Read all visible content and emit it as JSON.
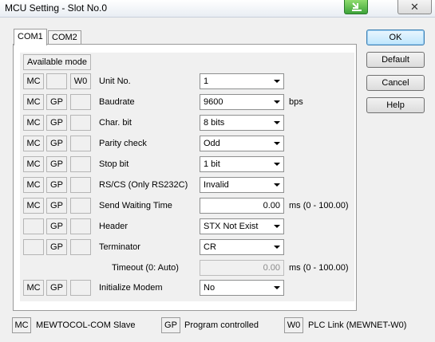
{
  "window": {
    "title": "MCU Setting - Slot No.0"
  },
  "tabs": [
    {
      "label": "COM1"
    },
    {
      "label": "COM2"
    }
  ],
  "available_mode_label": "Available mode",
  "rows": [
    {
      "mode": [
        "MC",
        "",
        "W0"
      ],
      "label": "Unit No.",
      "value": "1",
      "unit": ""
    },
    {
      "mode": [
        "MC",
        "GP",
        ""
      ],
      "label": "Baudrate",
      "value": "9600",
      "unit": "bps"
    },
    {
      "mode": [
        "MC",
        "GP",
        ""
      ],
      "label": "Char. bit",
      "value": "8 bits",
      "unit": ""
    },
    {
      "mode": [
        "MC",
        "GP",
        ""
      ],
      "label": "Parity check",
      "value": "Odd",
      "unit": ""
    },
    {
      "mode": [
        "MC",
        "GP",
        ""
      ],
      "label": "Stop bit",
      "value": "1 bit",
      "unit": ""
    },
    {
      "mode": [
        "MC",
        "GP",
        ""
      ],
      "label": "RS/CS (Only RS232C)",
      "value": "Invalid",
      "unit": ""
    },
    {
      "mode": [
        "MC",
        "GP",
        ""
      ],
      "label": "Send Waiting Time",
      "value": "0.00",
      "unit": "ms (0 - 100.00)"
    },
    {
      "mode": [
        "",
        "GP",
        ""
      ],
      "label": "Header",
      "value": "STX Not Exist",
      "unit": ""
    },
    {
      "mode": [
        "",
        "GP",
        ""
      ],
      "label": "Terminator",
      "value": "CR",
      "unit": ""
    },
    {
      "mode": [
        "",
        "",
        ""
      ],
      "label": "Timeout (0: Auto)",
      "value": "0.00",
      "unit": "ms (0 - 100.00)"
    },
    {
      "mode": [
        "MC",
        "GP",
        ""
      ],
      "label": "Initialize Modem",
      "value": "No",
      "unit": ""
    }
  ],
  "buttons": {
    "ok": "OK",
    "default": "Default",
    "cancel": "Cancel",
    "help": "Help"
  },
  "legend": [
    {
      "code": "MC",
      "text": "MEWTOCOL-COM Slave"
    },
    {
      "code": "GP",
      "text": "Program controlled"
    },
    {
      "code": "W0",
      "text": "PLC Link (MEWNET-W0)"
    }
  ]
}
